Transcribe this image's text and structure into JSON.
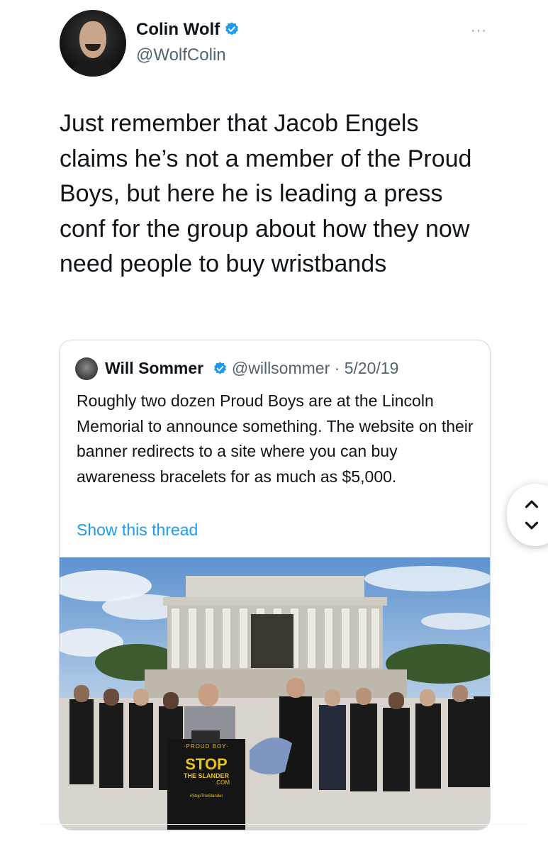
{
  "author": {
    "name": "Colin Wolf",
    "handle": "@WolfColin",
    "verified": true
  },
  "tweet": {
    "text": "Just remember that Jacob Engels claims he’s not a member of the Proud Boys, but here he is leading a press conf for the group about how they now need people to buy wristbands"
  },
  "more_label": "···",
  "quoted": {
    "name": "Will Sommer",
    "handle": "@willsommer",
    "separator": " · ",
    "date": "5/20/19",
    "text": "Roughly two dozen Proud Boys are at the Lincoln Memorial to announce something. The website on their banner redirects to a site where you can buy awareness bracelets for as much as $5,000.",
    "link": "Show this thread",
    "photo": {
      "podium_small": "·PROUD BOY·",
      "podium_big": "STOP",
      "podium_sub": "THE SLANDER",
      "podium_com": ".COM",
      "podium_tag": "#StopTheSlander"
    }
  },
  "colors": {
    "verified_blue": "#1d9bf0",
    "text": "#0f1419",
    "secondary": "#536471",
    "podium_yellow": "#e7c21a"
  },
  "icons": [
    "verified-badge-icon",
    "more-icon",
    "chevron-up-icon",
    "chevron-down-icon"
  ]
}
